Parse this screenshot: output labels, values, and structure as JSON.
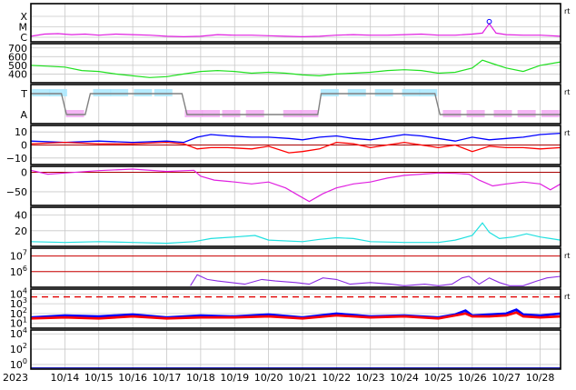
{
  "chart_data": {
    "type": "line",
    "x_axis": {
      "year_label": "2023",
      "range": [
        "10/13",
        "10/28"
      ],
      "tick_labels": [
        "10/14",
        "10/15",
        "10/16",
        "10/17",
        "10/18",
        "10/19",
        "10/20",
        "10/21",
        "10/22",
        "10/23",
        "10/24",
        "10/25",
        "10/26",
        "10/27",
        "10/28"
      ]
    },
    "grid": true,
    "panels": [
      {
        "id": "class",
        "kind": "category-line",
        "categories": [
          "C",
          "M",
          "X"
        ],
        "right_label": "rt",
        "color": "#e020e0",
        "x": [
          13.0,
          13.4,
          13.8,
          14.2,
          14.6,
          15.0,
          15.5,
          16.0,
          16.5,
          17.0,
          17.5,
          18.0,
          18.5,
          19.0,
          19.5,
          20.0,
          20.5,
          21.0,
          21.5,
          22.0,
          22.5,
          23.0,
          23.5,
          24.0,
          24.5,
          25.0,
          25.5,
          26.0,
          26.3,
          26.5,
          26.7,
          27.0,
          27.5,
          28.0,
          28.6
        ],
        "y": [
          0.1,
          0.3,
          0.35,
          0.25,
          0.3,
          0.2,
          0.3,
          0.25,
          0.2,
          0.1,
          0.05,
          0.1,
          0.25,
          0.2,
          0.2,
          0.15,
          0.1,
          0.05,
          0.1,
          0.2,
          0.25,
          0.2,
          0.2,
          0.25,
          0.3,
          0.2,
          0.2,
          0.3,
          0.4,
          1.3,
          0.4,
          0.25,
          0.2,
          0.2,
          0.1
        ],
        "marker": {
          "x": 26.5,
          "y": 1.5
        }
      },
      {
        "id": "speed",
        "ylim": [
          300,
          750
        ],
        "y_ticks": [
          400,
          500,
          600,
          700
        ],
        "color": "#20e020",
        "x": [
          13.0,
          13.5,
          14.0,
          14.5,
          15.0,
          15.5,
          16.0,
          16.5,
          17.0,
          17.5,
          18.0,
          18.5,
          19.0,
          19.5,
          20.0,
          20.5,
          21.0,
          21.5,
          22.0,
          22.5,
          23.0,
          23.5,
          24.0,
          24.5,
          25.0,
          25.5,
          26.0,
          26.3,
          26.6,
          27.0,
          27.5,
          28.0,
          28.6
        ],
        "y": [
          500,
          490,
          480,
          440,
          430,
          400,
          380,
          360,
          370,
          400,
          430,
          440,
          430,
          410,
          420,
          410,
          390,
          380,
          400,
          410,
          420,
          440,
          450,
          440,
          410,
          420,
          470,
          560,
          520,
          470,
          430,
          500,
          540
        ]
      },
      {
        "id": "sector",
        "kind": "sector",
        "categories": [
          "A",
          "T"
        ],
        "right_label": "rt",
        "colors": {
          "T": "#a8e8ff",
          "A": "#f2a8f2",
          "step": "#808080"
        },
        "step_x": [
          13.0,
          13.9,
          14.05,
          14.6,
          14.75,
          17.45,
          17.6,
          20.0,
          21.3,
          21.45,
          21.55,
          24.9,
          25.05,
          28.6
        ],
        "step_y": [
          1,
          1,
          0,
          0,
          1,
          1,
          0,
          0,
          0,
          0,
          1,
          1,
          0,
          0
        ],
        "dots": [
          {
            "x": 13.3,
            "v": 1
          },
          {
            "x": 13.8,
            "v": 1
          },
          {
            "x": 14.3,
            "v": 0
          },
          {
            "x": 15.1,
            "v": 1
          },
          {
            "x": 15.6,
            "v": 1
          },
          {
            "x": 16.3,
            "v": 1
          },
          {
            "x": 16.9,
            "v": 1
          },
          {
            "x": 17.8,
            "v": 0
          },
          {
            "x": 18.3,
            "v": 0
          },
          {
            "x": 18.9,
            "v": 0
          },
          {
            "x": 19.6,
            "v": 0
          },
          {
            "x": 20.7,
            "v": 0
          },
          {
            "x": 21.2,
            "v": 0
          },
          {
            "x": 21.8,
            "v": 1
          },
          {
            "x": 22.6,
            "v": 1
          },
          {
            "x": 23.4,
            "v": 1
          },
          {
            "x": 24.2,
            "v": 1
          },
          {
            "x": 24.7,
            "v": 1
          },
          {
            "x": 25.4,
            "v": 0
          },
          {
            "x": 26.1,
            "v": 0
          },
          {
            "x": 26.9,
            "v": 0
          },
          {
            "x": 27.6,
            "v": 0
          },
          {
            "x": 28.3,
            "v": 0
          }
        ]
      },
      {
        "id": "imf",
        "ylim": [
          -15,
          15
        ],
        "y_ticks": [
          -10,
          0,
          10
        ],
        "right_label": "rt",
        "zero_line": true,
        "series": [
          {
            "color": "#0000ff",
            "x": [
              13.0,
              14.0,
              15.0,
              16.0,
              17.0,
              17.5,
              17.9,
              18.3,
              18.8,
              19.5,
              20.0,
              20.6,
              21.0,
              21.5,
              22.0,
              22.5,
              23.0,
              23.5,
              24.0,
              24.5,
              25.0,
              25.5,
              26.0,
              26.5,
              27.0,
              27.5,
              28.0,
              28.6
            ],
            "y": [
              3,
              2,
              3,
              2,
              3,
              2,
              6,
              8,
              7,
              6,
              6,
              5,
              4,
              6,
              7,
              5,
              4,
              6,
              8,
              7,
              5,
              3,
              6,
              4,
              5,
              6,
              8,
              9
            ]
          },
          {
            "color": "#ff0000",
            "x": [
              13.0,
              14.0,
              15.0,
              16.0,
              17.0,
              17.5,
              17.9,
              18.3,
              18.8,
              19.5,
              20.0,
              20.6,
              21.0,
              21.5,
              22.0,
              22.5,
              23.0,
              23.5,
              24.0,
              24.5,
              25.0,
              25.5,
              26.0,
              26.5,
              27.0,
              27.5,
              28.0,
              28.6
            ],
            "y": [
              1,
              2,
              1,
              1,
              2,
              1,
              -3,
              -2,
              -2,
              -3,
              -1,
              -6,
              -5,
              -3,
              2,
              1,
              -2,
              0,
              2,
              0,
              -2,
              0,
              -5,
              -1,
              -2,
              -2,
              -3,
              -2
            ]
          }
        ]
      },
      {
        "id": "dst",
        "ylim": [
          -85,
          15
        ],
        "y_ticks": [
          -50,
          0
        ],
        "zero_line": true,
        "color": "#e020e0",
        "x": [
          13.0,
          13.5,
          14.0,
          15.0,
          16.0,
          17.0,
          17.8,
          18.0,
          18.4,
          19.0,
          19.5,
          20.0,
          20.5,
          20.9,
          21.2,
          21.6,
          22.0,
          22.5,
          23.0,
          23.5,
          24.0,
          24.5,
          25.0,
          25.5,
          25.9,
          26.2,
          26.6,
          27.0,
          27.5,
          28.0,
          28.3,
          28.6
        ],
        "y": [
          5,
          -5,
          -2,
          4,
          8,
          2,
          5,
          -10,
          -20,
          -25,
          -30,
          -25,
          -40,
          -60,
          -75,
          -55,
          -40,
          -30,
          -25,
          -15,
          -8,
          -5,
          -2,
          -3,
          -5,
          -20,
          -35,
          -30,
          -25,
          -30,
          -45,
          -30
        ]
      },
      {
        "id": "pressure",
        "ylim": [
          0,
          50
        ],
        "y_ticks": [
          20,
          40
        ],
        "color": "#20e0e0",
        "x": [
          13.0,
          14.0,
          15.0,
          16.0,
          17.0,
          17.8,
          18.3,
          19.0,
          19.6,
          20.0,
          21.0,
          21.5,
          22.0,
          22.5,
          23.0,
          24.0,
          25.0,
          25.5,
          26.0,
          26.3,
          26.5,
          26.8,
          27.2,
          27.6,
          28.0,
          28.3,
          28.6
        ],
        "y": [
          6,
          5,
          6,
          5,
          4,
          6,
          10,
          12,
          14,
          8,
          6,
          9,
          11,
          10,
          6,
          5,
          5,
          8,
          14,
          30,
          18,
          10,
          12,
          16,
          12,
          10,
          8
        ]
      },
      {
        "id": "electron",
        "scale": "log",
        "ylim_exp": [
          5,
          7.5
        ],
        "y_ticks_exp": [
          6,
          7
        ],
        "right_label": "rt",
        "ref_lines_exp": [
          7,
          6
        ],
        "ref_color": "#cc0000",
        "color": "#8a2be2",
        "x": [
          17.7,
          17.9,
          18.2,
          18.5,
          18.9,
          19.3,
          19.8,
          20.2,
          20.8,
          21.2,
          21.6,
          22.0,
          22.4,
          23.0,
          23.6,
          24.0,
          24.6,
          25.0,
          25.4,
          25.7,
          25.9,
          26.2,
          26.5,
          26.8,
          27.1,
          27.5,
          27.9,
          28.2,
          28.6
        ],
        "y_exp": [
          5.1,
          5.8,
          5.5,
          5.4,
          5.3,
          5.2,
          5.5,
          5.4,
          5.3,
          5.2,
          5.6,
          5.5,
          5.2,
          5.3,
          5.2,
          5.1,
          5.2,
          5.1,
          5.2,
          5.6,
          5.7,
          5.2,
          5.6,
          5.3,
          5.1,
          5.1,
          5.4,
          5.6,
          5.7
        ]
      },
      {
        "id": "proton",
        "scale": "log",
        "ylim_exp": [
          0.5,
          4.5
        ],
        "y_ticks_exp": [
          1,
          2,
          3,
          4
        ],
        "right_label": "rt",
        "ref_dashed_exp": 3.7,
        "ref_color": "#e00000",
        "series": [
          {
            "color": "#0000ff",
            "x": [
              13.0,
              14.0,
              15.0,
              16.0,
              17.0,
              18.0,
              19.0,
              20.0,
              21.0,
              22.0,
              23.0,
              24.0,
              25.0,
              25.5,
              25.8,
              26.0,
              26.5,
              27.0,
              27.3,
              27.5,
              28.0,
              28.6
            ],
            "y_exp": [
              1.6,
              1.8,
              1.7,
              1.9,
              1.6,
              1.8,
              1.7,
              1.9,
              1.6,
              2.0,
              1.7,
              1.8,
              1.6,
              1.9,
              2.3,
              1.8,
              1.9,
              2.0,
              2.4,
              1.9,
              1.8,
              2.0
            ]
          },
          {
            "color": "#ff0000",
            "x": [
              13.0,
              14.0,
              15.0,
              16.0,
              17.0,
              18.0,
              19.0,
              20.0,
              21.0,
              22.0,
              23.0,
              24.0,
              25.0,
              25.5,
              25.8,
              26.0,
              26.5,
              27.0,
              27.3,
              27.5,
              28.0,
              28.6
            ],
            "y_exp": [
              1.5,
              1.6,
              1.5,
              1.7,
              1.5,
              1.6,
              1.6,
              1.7,
              1.5,
              1.8,
              1.6,
              1.7,
              1.5,
              1.8,
              2.0,
              1.7,
              1.7,
              1.8,
              2.1,
              1.7,
              1.6,
              1.7
            ]
          }
        ]
      },
      {
        "id": "neutron",
        "scale": "log",
        "ylim_exp": [
          -0.6,
          4.5
        ],
        "y_ticks_exp": [
          0,
          2,
          4
        ],
        "color": "#0000aa",
        "x": [
          13.0,
          16.0,
          20.0,
          24.0,
          28.6
        ],
        "y_exp": [
          -0.45,
          -0.45,
          -0.45,
          -0.45,
          -0.45
        ]
      }
    ]
  }
}
